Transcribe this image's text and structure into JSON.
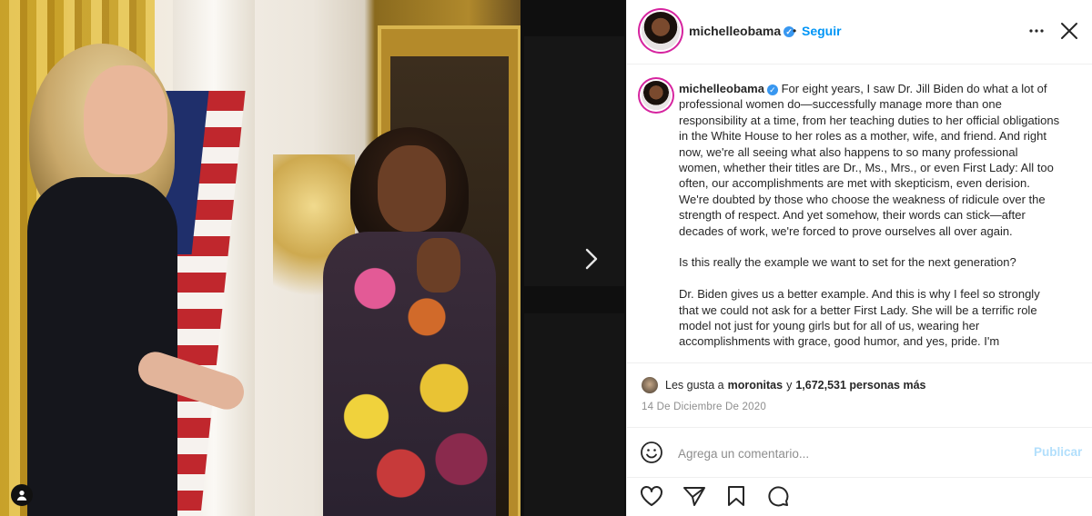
{
  "post": {
    "username": "michelleobama",
    "follow_label": "Seguir",
    "header_separator": "•",
    "verified_glyph": "✓"
  },
  "caption": {
    "username": "michelleobama",
    "paragraphs": [
      "For eight years, I saw Dr. Jill Biden do what a lot of professional women do—successfully manage more than one responsibility at a time, from her teaching duties to her official obligations in the White House to her roles as a mother, wife, and friend. And right now, we're all seeing what also happens to so many professional women, whether their titles are Dr., Ms., Mrs., or even First Lady: All too often, our accomplishments are met with skepticism, even derision. We're doubted by those who choose the weakness of ridicule over the strength of respect. And yet somehow, their words can stick—after decades of work, we're forced to prove ourselves all over again.",
      "Is this really the example we want to set for the next generation?",
      "Dr. Biden gives us a better example. And this is why I feel so strongly that we could not ask for a better First Lady. She will be a terrific role model not just for young girls but for all of us, wearing her accomplishments with grace, good humor, and yes, pride. I'm"
    ]
  },
  "likes": {
    "prefix": "Les gusta a",
    "user": "moronitas",
    "joiner": "y",
    "count_text": "1,672,531 personas más"
  },
  "date": "14 De Diciembre De 2020",
  "comment": {
    "placeholder": "Agrega un comentario...",
    "publish_label": "Publicar"
  },
  "icons": {
    "more": "more-options-icon",
    "close": "close-icon",
    "next": "chevron-right-icon",
    "emoji": "emoji-icon",
    "like": "heart-icon",
    "share": "send-icon",
    "save": "bookmark-icon",
    "comment": "comment-icon",
    "tag": "user-tag-icon"
  },
  "colors": {
    "link_blue": "#0095f6",
    "publish_disabled": "#b2dffc",
    "verified": "#3897f0",
    "story_ring": "#d6249f"
  }
}
